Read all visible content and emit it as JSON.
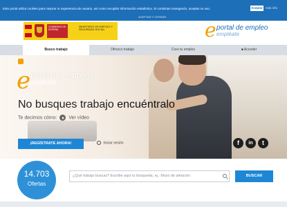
{
  "cookie_bar": {
    "text": "Este portal utiliza cookies para mejorar tu experiencia de usuario, así como recopilar información estadística. Si continúas navegando, aceptas su uso.",
    "accept_label": "Aceptar",
    "more_info_label": "más info",
    "sub_text": "ACEPTAR Y CERRAR",
    "color": "#1d6fb8"
  },
  "header": {
    "gov_label": "GOBIERNO DE ESPAÑA",
    "ministry_label": "MINISTERIO DE EMPLEO Y SEGURIDAD SOCIAL",
    "brand_letter": "e",
    "brand_name": "portal de empleo",
    "brand_tagline": "empléate"
  },
  "nav": {
    "items": [
      {
        "label": "Busco trabajo",
        "active": true
      },
      {
        "label": "Ofrezco trabajo",
        "active": false
      },
      {
        "label": "Creo tu empleo",
        "active": false
      },
      {
        "label": "Acceder",
        "active": false
      }
    ]
  },
  "hero": {
    "brand_letter": "e",
    "brand_name": "portal de empleo",
    "brand_tagline": "empléate",
    "headline_plain": "No busques trabajo",
    "headline_bold": "encuéntralo",
    "video_prefix": "Te decimos cómo:",
    "video_label": "Ver vídeo",
    "register_label": "¡REGÍSTRATE AHORA!",
    "login_label": "Iniciar sesión",
    "social": [
      "f",
      "in",
      "t"
    ]
  },
  "search": {
    "offers_count": "14.703",
    "offers_label": "Ofertas",
    "placeholder": "¿Qué trabajo buscas? Escribe aquí tu búsqueda, ej.: Mozo de almacén",
    "button_label": "BUSCAR"
  },
  "colors": {
    "accent_blue": "#1d87d6",
    "brand_orange": "#f1a000",
    "gov_yellow": "#f7d117",
    "gov_red": "#c0262d"
  }
}
